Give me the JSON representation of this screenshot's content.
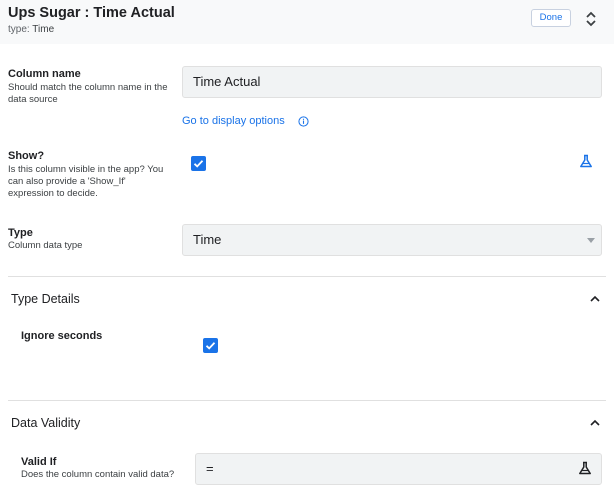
{
  "header": {
    "title": "Ups Sugar : Time Actual",
    "type_prefix": "type:",
    "type_value": "Time",
    "done_label": "Done"
  },
  "column_name": {
    "label": "Column name",
    "help": "Should match the column name in the data source",
    "value": "Time Actual",
    "link": "Go to display options"
  },
  "show": {
    "label": "Show?",
    "help": "Is this column visible in the app? You can also provide a 'Show_If' expression to decide.",
    "checked": true
  },
  "type": {
    "label": "Type",
    "help": "Column data type",
    "value": "Time"
  },
  "type_details": {
    "title": "Type Details",
    "ignore_seconds_label": "Ignore seconds",
    "ignore_seconds_checked": true
  },
  "data_validity": {
    "title": "Data Validity",
    "valid_if_label": "Valid If",
    "valid_if_help": "Does the column contain valid data?",
    "valid_if_value": "="
  },
  "colors": {
    "accent": "#1a73e8",
    "field_bg": "#f1f3f4",
    "header_bg": "#f8f9fa"
  }
}
